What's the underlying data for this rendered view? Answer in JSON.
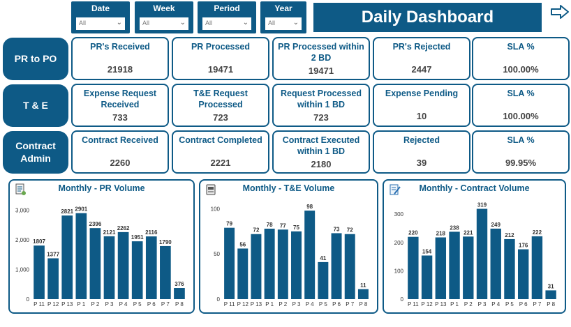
{
  "filters": [
    {
      "label": "Date",
      "value": "All"
    },
    {
      "label": "Week",
      "value": "All"
    },
    {
      "label": "Period",
      "value": "All"
    },
    {
      "label": "Year",
      "value": "All"
    }
  ],
  "header": {
    "title": "Daily Dashboard"
  },
  "rows": [
    {
      "label": "PR to PO",
      "cards": [
        {
          "title": "PR's Received",
          "value": "21918"
        },
        {
          "title": "PR Processed",
          "value": "19471"
        },
        {
          "title": "PR Processed within 2 BD",
          "value": "19471"
        },
        {
          "title": "PR's Rejected",
          "value": "2447"
        },
        {
          "title": "SLA %",
          "value": "100.00%"
        }
      ]
    },
    {
      "label": "T & E",
      "cards": [
        {
          "title": "Expense Request Received",
          "value": "733"
        },
        {
          "title": "T&E Request Processed",
          "value": "723"
        },
        {
          "title": "Request Processed within 1 BD",
          "value": "723"
        },
        {
          "title": "Expense Pending",
          "value": "10"
        },
        {
          "title": "SLA %",
          "value": "100.00%"
        }
      ]
    },
    {
      "label": "Contract Admin",
      "cards": [
        {
          "title": "Contract Received",
          "value": "2260"
        },
        {
          "title": "Contract Completed",
          "value": "2221"
        },
        {
          "title": "Contract Executed within 1 BD",
          "value": "2180"
        },
        {
          "title": "Rejected",
          "value": "39"
        },
        {
          "title": "SLA %",
          "value": "99.95%"
        }
      ]
    }
  ],
  "chart_data": [
    {
      "type": "bar",
      "title": "Monthly - PR Volume",
      "categories": [
        "P 11",
        "P 12",
        "P 13",
        "P 1",
        "P 2",
        "P 3",
        "P 4",
        "P 5",
        "P 6",
        "P 7",
        "P 8"
      ],
      "values": [
        1807,
        1377,
        2821,
        2901,
        2396,
        2121,
        2262,
        1951,
        2116,
        1790,
        376
      ],
      "ylim": [
        0,
        3200
      ],
      "yticks": [
        0,
        1000,
        2000,
        3000
      ],
      "ytick_labels": [
        "0",
        "1,000",
        "2,000",
        "3,000"
      ],
      "grid": false,
      "color": "#0e5a86",
      "icon": "document-pen-icon"
    },
    {
      "type": "bar",
      "title": "Monthly - T&E Volume",
      "categories": [
        "P 11",
        "P 12",
        "P 13",
        "P 1",
        "P 2",
        "P 3",
        "P 4",
        "P 5",
        "P 6",
        "P 7",
        "P 8"
      ],
      "values": [
        79,
        56,
        72,
        78,
        77,
        75,
        98,
        41,
        73,
        72,
        11
      ],
      "ylim": [
        0,
        105
      ],
      "yticks": [
        0,
        50,
        100
      ],
      "ytick_labels": [
        "0",
        "50",
        "100"
      ],
      "grid": false,
      "color": "#0e5a86",
      "icon": "receipt-card-icon"
    },
    {
      "type": "bar",
      "title": "Monthly - Contract Volume",
      "categories": [
        "P 11",
        "P 12",
        "P 13",
        "P 1",
        "P 2",
        "P 3",
        "P 4",
        "P 5",
        "P 6",
        "P 7",
        "P 8"
      ],
      "values": [
        220,
        154,
        218,
        238,
        221,
        319,
        249,
        212,
        176,
        222,
        31
      ],
      "ylim": [
        0,
        335
      ],
      "yticks": [
        0,
        100,
        200,
        300
      ],
      "ytick_labels": [
        "0",
        "100",
        "200",
        "300"
      ],
      "grid": false,
      "color": "#0e5a86",
      "icon": "clipboard-pen-icon"
    }
  ],
  "colors": {
    "brand": "#0e5a86",
    "value_text": "#444444"
  }
}
